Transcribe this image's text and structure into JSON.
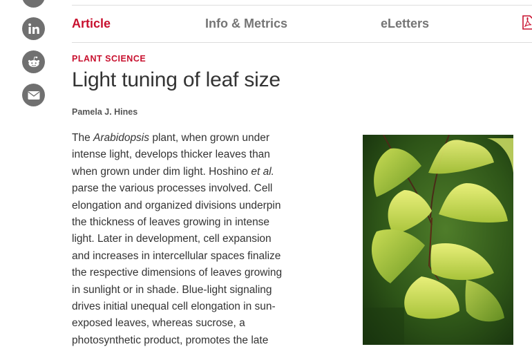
{
  "tabs": {
    "article": "Article",
    "info_metrics": "Info & Metrics",
    "eletters": "eLetters"
  },
  "social": [
    "linkedin-icon",
    "reddit-icon",
    "email-icon"
  ],
  "article": {
    "section": "PLANT SCIENCE",
    "title": "Light tuning of leaf size",
    "author": "Pamela J. Hines",
    "body_lines": [
      [
        "The ",
        "Arabidopsis",
        " plant, when grown under"
      ],
      [
        "intense light, develops thicker leaves than"
      ],
      [
        "when grown under dim light. Hoshino ",
        "et al.",
        ""
      ],
      [
        "parse the various processes involved. Cell"
      ],
      [
        "elongation and organized divisions underpin"
      ],
      [
        "the thickness of leaves growing in intense"
      ],
      [
        "light. Later in development, cell expansion"
      ],
      [
        "and increases in intercellular spaces finalize"
      ],
      [
        "the respective dimensions of leaves growing"
      ],
      [
        "in sunlight or in shade. Blue-light signaling"
      ],
      [
        "drives initial unequal cell elongation in sun-"
      ],
      [
        "exposed leaves, whereas sucrose, a"
      ],
      [
        "photosynthetic product, promotes the late"
      ]
    ]
  },
  "colors": {
    "accent": "#c8102e",
    "icon_gray": "#707070"
  }
}
